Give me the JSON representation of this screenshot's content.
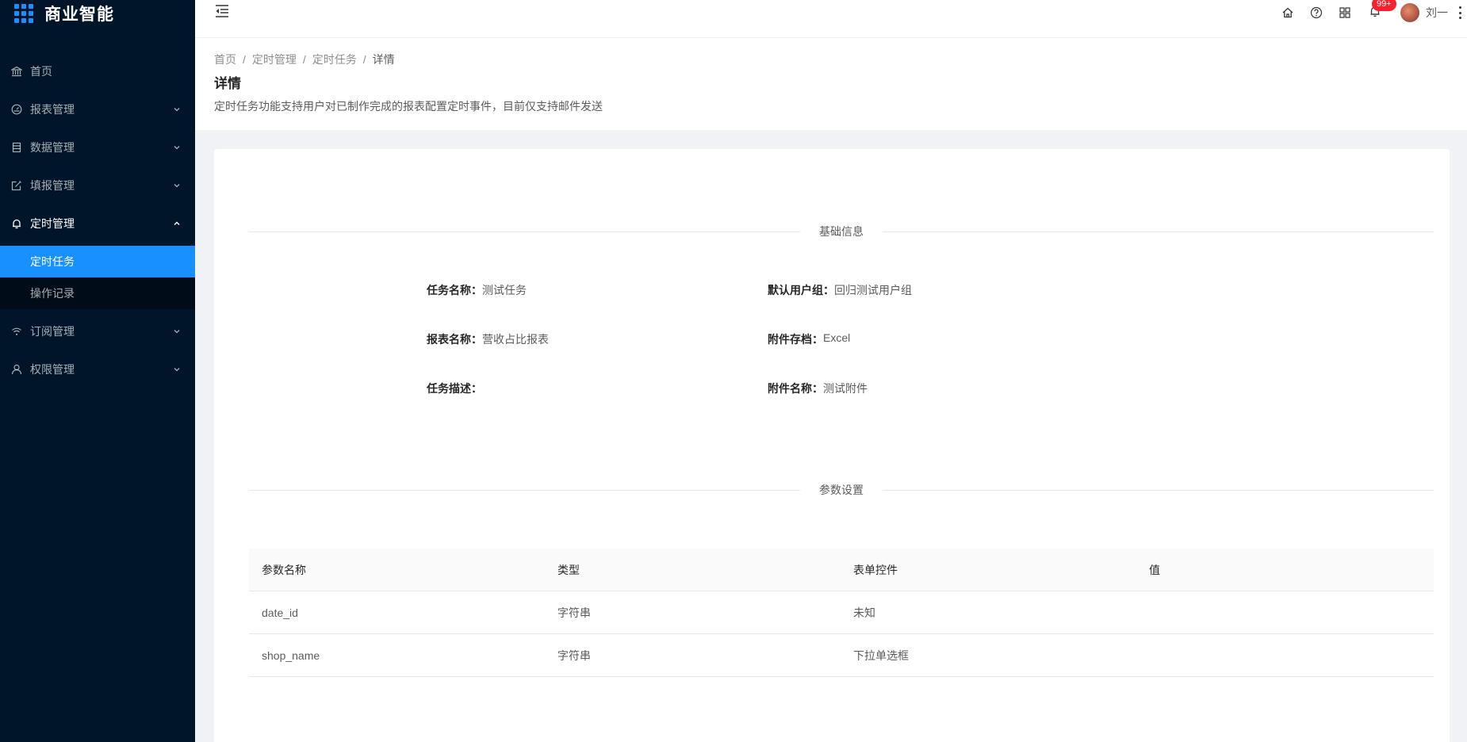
{
  "app": {
    "title": "商业智能"
  },
  "sidebar": {
    "items": [
      {
        "label": "首页",
        "icon": "bank-icon"
      },
      {
        "label": "报表管理",
        "icon": "dashboard-icon"
      },
      {
        "label": "数据管理",
        "icon": "database-icon"
      },
      {
        "label": "填报管理",
        "icon": "edit-icon"
      },
      {
        "label": "定时管理",
        "icon": "bell-icon",
        "open": true,
        "children": [
          {
            "label": "定时任务",
            "active": true
          },
          {
            "label": "操作记录"
          }
        ]
      },
      {
        "label": "订阅管理",
        "icon": "wifi-icon"
      },
      {
        "label": "权限管理",
        "icon": "user-icon"
      }
    ]
  },
  "header": {
    "notification_count": "99+",
    "username": "刘一"
  },
  "breadcrumb": [
    "首页",
    "定时管理",
    "定时任务",
    "详情"
  ],
  "page": {
    "title": "详情",
    "description": "定时任务功能支持用户对已制作完成的报表配置定时事件，目前仅支持邮件发送"
  },
  "basic_info": {
    "section_title": "基础信息",
    "task_name_label": "任务名称：",
    "task_name": "测试任务",
    "default_group_label": "默认用户组：",
    "default_group": "回归测试用户组",
    "report_name_label": "报表名称：",
    "report_name": "营收占比报表",
    "attachment_format_label": "附件存档：",
    "attachment_format": "Excel",
    "task_desc_label": "任务描述：",
    "task_desc": "",
    "attachment_name_label": "附件名称：",
    "attachment_name": "测试附件"
  },
  "params": {
    "section_title": "参数设置",
    "columns": [
      "参数名称",
      "类型",
      "表单控件",
      "值"
    ],
    "rows": [
      [
        "date_id",
        "字符串",
        "未知",
        ""
      ],
      [
        "shop_name",
        "字符串",
        "下拉单选框",
        ""
      ]
    ]
  },
  "colors": {
    "sidebar_bg": "#001529",
    "accent": "#1890ff",
    "badge": "#f5222d"
  }
}
